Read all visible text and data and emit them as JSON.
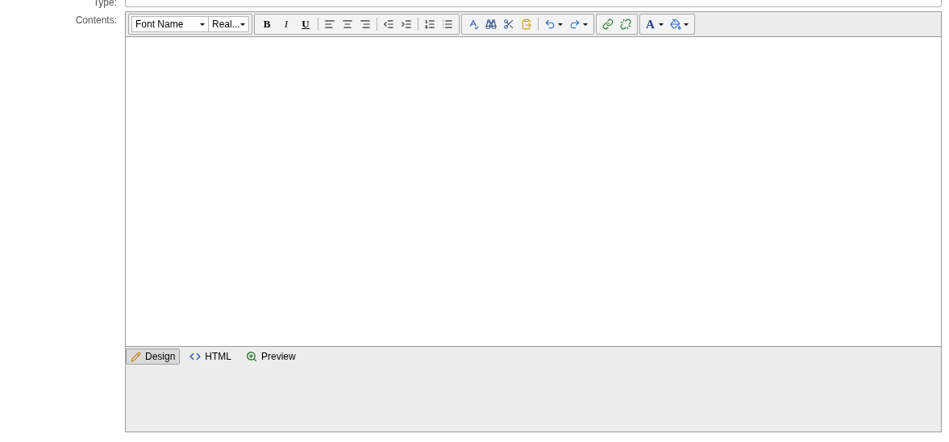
{
  "form": {
    "type_label": "Type:",
    "contents_label": "Contents:"
  },
  "editor": {
    "font_name": "Font Name",
    "font_size": "Real...",
    "format_buttons": [
      "B",
      "I",
      "U"
    ],
    "font_color_button": "A",
    "tabs": [
      {
        "kind": "design",
        "label": "Design",
        "selected": true
      },
      {
        "kind": "html",
        "label": "HTML",
        "selected": false
      },
      {
        "kind": "preview",
        "label": "Preview",
        "selected": false
      }
    ]
  }
}
